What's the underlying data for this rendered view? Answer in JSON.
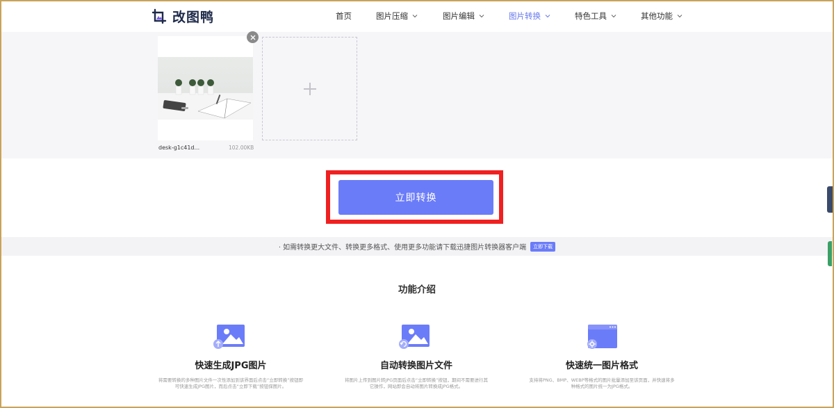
{
  "brand": {
    "name": "改图鸭"
  },
  "nav": [
    {
      "label": "首页",
      "has_dropdown": false,
      "active": false
    },
    {
      "label": "图片压缩",
      "has_dropdown": true,
      "active": false
    },
    {
      "label": "图片编辑",
      "has_dropdown": true,
      "active": false
    },
    {
      "label": "图片转换",
      "has_dropdown": true,
      "active": true
    },
    {
      "label": "特色工具",
      "has_dropdown": true,
      "active": false
    },
    {
      "label": "其他功能",
      "has_dropdown": true,
      "active": false
    }
  ],
  "upload": {
    "file_name": "desk-g1c41d...",
    "file_size": "102.00KB",
    "add_icon": "plus-icon",
    "remove_icon": "close-icon"
  },
  "convert_button": {
    "label": "立即转换"
  },
  "notice": {
    "text": "· 如需转换更大文件、转换更多格式、使用更多功能请下载迅捷图片转换器客户端",
    "link_label": "立即下载"
  },
  "features": {
    "title": "功能介绍",
    "items": [
      {
        "title": "快速生成JPG图片",
        "desc": "将需要转换的多种图片文件一次性添加到该界面后点击“立即转换”按钮即可快速生成JPG图片，而后点击“立即下载”按钮保图片。",
        "icon": "image-upload-icon"
      },
      {
        "title": "自动转换图片文件",
        "desc": "将图片上传到图片转JPG页面后点击“立即转换”按钮，期间不需要进行其它操作，网站即会自动将图片转换成JPG格式。",
        "icon": "image-refresh-icon"
      },
      {
        "title": "快速统一图片格式",
        "desc": "支持将PNG、BMP、WEBP等格式的图片批量添加至该页面，并快速将多种格式的图片统一为JPG格式。",
        "icon": "browser-settings-icon"
      }
    ]
  },
  "colors": {
    "accent": "#6b7cf9",
    "active_nav": "#6677ee",
    "highlight": "#f02020",
    "frame": "#c9a35a"
  }
}
